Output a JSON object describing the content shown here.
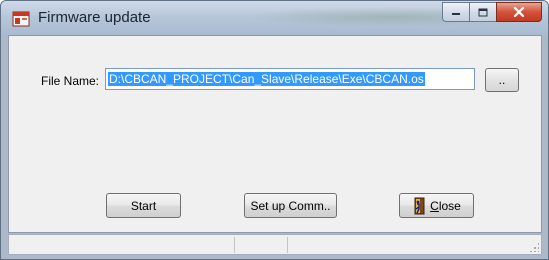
{
  "window": {
    "title": "Firmware update",
    "caption_buttons": [
      "minimize",
      "maximize",
      "close"
    ]
  },
  "form": {
    "file_name_label": "File Name:",
    "file_name_value": "D:\\CBCAN_PROJECT\\Can_Slave\\Release\\Exe\\CBCAN.os",
    "browse_label": ".."
  },
  "buttons": {
    "start": "Start",
    "setup": "Set up Comm..",
    "close_mnemonic": "C",
    "close_rest": "lose"
  },
  "icons": {
    "app": "app-window-icon",
    "close_door": "exit-door-icon"
  },
  "colors": {
    "selection": "#3399ff",
    "close_caption": "#c23a22"
  }
}
